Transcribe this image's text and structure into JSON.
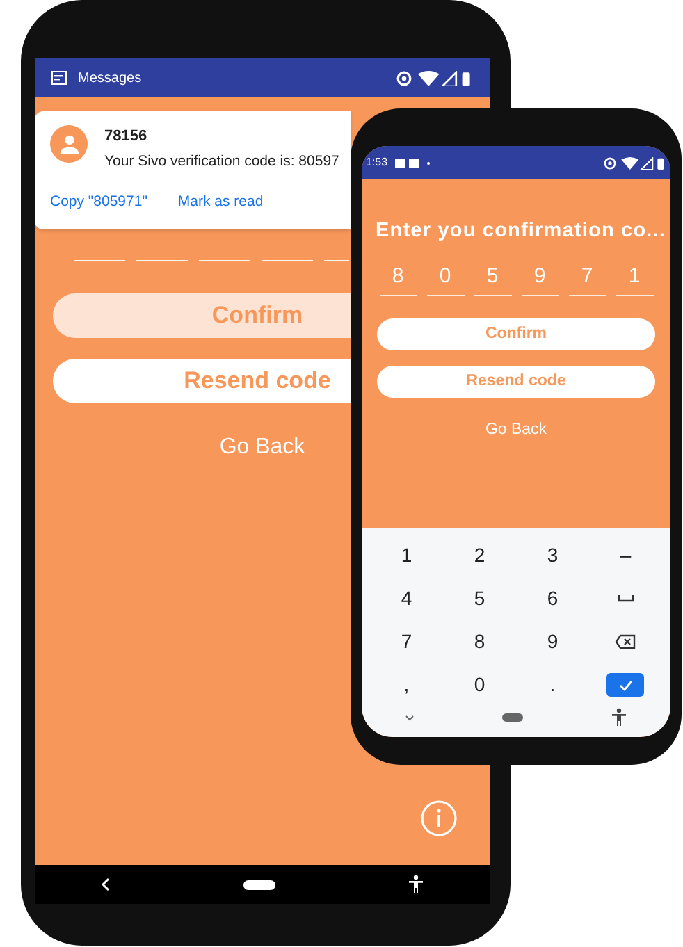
{
  "main_phone": {
    "status_bar": {
      "app_name": "Messages"
    },
    "notification": {
      "sender": "78156",
      "message": "Your Sivo verification code is: 80597",
      "actions": [
        "Copy \"805971\"",
        "Mark as read"
      ]
    },
    "buttons": [
      {
        "label": "Confirm",
        "disabled": true
      },
      {
        "label": "Resend code",
        "disabled": false
      }
    ],
    "link": "Go Back"
  },
  "second_phone": {
    "status_bar": {
      "time": "1:53"
    },
    "title": "Enter you confirmation co...",
    "code_digits": [
      "8",
      "0",
      "5",
      "9",
      "7",
      "1"
    ],
    "buttons": [
      {
        "label": "Confirm",
        "disabled": false
      },
      {
        "label": "Resend code",
        "disabled": false
      }
    ],
    "link": "Go Back",
    "keyboard": [
      {
        "kind": "text",
        "label": "1"
      },
      {
        "kind": "text",
        "label": "2"
      },
      {
        "kind": "text",
        "label": "3"
      },
      {
        "kind": "text",
        "label": "–"
      },
      {
        "kind": "text",
        "label": "4"
      },
      {
        "kind": "text",
        "label": "5"
      },
      {
        "kind": "text",
        "label": "6"
      },
      {
        "kind": "space"
      },
      {
        "kind": "text",
        "label": "7"
      },
      {
        "kind": "text",
        "label": "8"
      },
      {
        "kind": "text",
        "label": "9"
      },
      {
        "kind": "backspace"
      },
      {
        "kind": "text",
        "label": ","
      },
      {
        "kind": "text",
        "label": "0"
      },
      {
        "kind": "text",
        "label": "."
      },
      {
        "kind": "done"
      }
    ]
  }
}
